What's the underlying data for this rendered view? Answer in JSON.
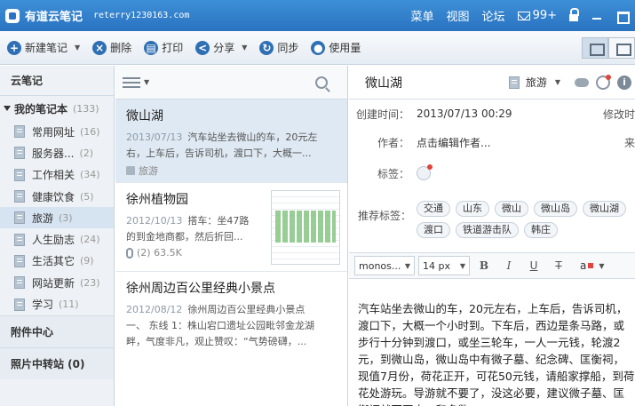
{
  "titlebar": {
    "app_name": "有道云笔记",
    "account": "reterry1230163.com",
    "menu": "菜单",
    "view": "视图",
    "forum": "论坛",
    "mail_count": "99+"
  },
  "toolbar": {
    "new_note": "新建笔记",
    "delete": "删除",
    "print": "打印",
    "share": "分享",
    "sync": "同步",
    "usage": "使用量"
  },
  "sidebar": {
    "header": "云笔记",
    "root_label": "我的笔记本",
    "root_count": "(133)",
    "items": [
      {
        "label": "常用网址",
        "count": "(16)"
      },
      {
        "label": "服务器...",
        "count": "(2)"
      },
      {
        "label": "工作相关",
        "count": "(34)"
      },
      {
        "label": "健康饮食",
        "count": "(5)"
      },
      {
        "label": "旅游",
        "count": "(3)"
      },
      {
        "label": "人生励志",
        "count": "(24)"
      },
      {
        "label": "生活其它",
        "count": "(9)"
      },
      {
        "label": "网站更新",
        "count": "(23)"
      },
      {
        "label": "学习",
        "count": "(11)"
      }
    ],
    "attach_center": "附件中心",
    "photo_transfer": "照片中转站 (0)"
  },
  "notes": [
    {
      "title": "微山湖",
      "date": "2013/07/13",
      "line1": "汽车站坐去微山的车，20元左",
      "line2": "右，上车后，告诉司机，渡口下，大概一...",
      "tag": "旅游"
    },
    {
      "title": "徐州植物园",
      "date": "2012/10/13",
      "line1": "搭车：坐47路",
      "line2": "的到金地商都，然后折回...",
      "attach": "(2) 63.5K"
    },
    {
      "title": "徐州周边百公里经典小景点",
      "date": "2012/08/12",
      "line1": "徐州周边百公里经典小景点",
      "line2": "一、 东线 1：株山宕口遗址公园毗邻金龙湖",
      "line3": "畔，气度非凡，观止赞叹：“气势磅礴，..."
    }
  ],
  "editor": {
    "title": "微山湖",
    "notebook": "旅游",
    "created_label": "创建时间：",
    "created_value": "2013/07/13 00:29",
    "modified_label": "修改时",
    "author_label": "作者：",
    "author_value": "点击编辑作者...",
    "author_right": "来",
    "tags_label": "标签：",
    "recommend_label": "推荐标签：",
    "recommend_tags": [
      "交通",
      "山东",
      "微山",
      "微山岛",
      "微山湖",
      "渡口",
      "铁道游击队",
      "韩庄"
    ],
    "font": "monos...",
    "size": "14 px",
    "color_label": "a",
    "content": "汽车站坐去微山的车，20元左右，上车后，告诉司机，渡口下，大概一个小时到。下车后，西边是条马路，或步行十分钟到渡口，或坐三轮车，一人一元钱，轮渡2元，到微山岛，微山岛中有微子墓、纪念碑、匡衡祠，现值7月份，荷花正开，可花50元钱，请船家撑船，到荷花处游玩。导游就不要了，没这必要，建议微子墓、匡衡祠就不要去，和多数"
  }
}
